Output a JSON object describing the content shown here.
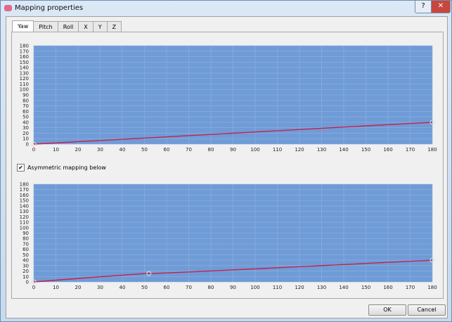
{
  "window": {
    "title": "Mapping properties",
    "help_label": "?",
    "close_label": "✕"
  },
  "tabs": [
    {
      "label": "Yaw",
      "active": true
    },
    {
      "label": "Pitch"
    },
    {
      "label": "Roll"
    },
    {
      "label": "X"
    },
    {
      "label": "Y"
    },
    {
      "label": "Z"
    }
  ],
  "asymmetric": {
    "label": "Asymmetric mapping below",
    "checked": true,
    "check_glyph": "✔"
  },
  "buttons": {
    "ok": "OK",
    "cancel": "Cancel"
  },
  "colors": {
    "plot_bg": "#6f9bd6",
    "grid": "#8fb3e3",
    "curve": "#c8204a"
  },
  "chart_data": [
    {
      "type": "line",
      "xlim": [
        0,
        180
      ],
      "ylim": [
        0,
        180
      ],
      "grid": true,
      "xticks": [
        0,
        10,
        20,
        30,
        40,
        50,
        60,
        70,
        80,
        90,
        100,
        110,
        120,
        130,
        140,
        150,
        160,
        170,
        180
      ],
      "yticks": [
        0,
        10,
        20,
        30,
        40,
        50,
        60,
        70,
        80,
        90,
        100,
        110,
        120,
        130,
        140,
        150,
        160,
        170,
        180
      ],
      "points": [
        [
          0,
          0
        ],
        [
          180,
          40
        ]
      ],
      "handles": [
        [
          0,
          0
        ],
        [
          180,
          40
        ]
      ]
    },
    {
      "type": "line",
      "xlim": [
        0,
        180
      ],
      "ylim": [
        0,
        180
      ],
      "grid": true,
      "xticks": [
        0,
        10,
        20,
        30,
        40,
        50,
        60,
        70,
        80,
        90,
        100,
        110,
        120,
        130,
        140,
        150,
        160,
        170,
        180
      ],
      "yticks": [
        0,
        10,
        20,
        30,
        40,
        50,
        60,
        70,
        80,
        90,
        100,
        110,
        120,
        130,
        140,
        150,
        160,
        170,
        180
      ],
      "points": [
        [
          0,
          0
        ],
        [
          52,
          15.5
        ],
        [
          180,
          40
        ]
      ],
      "handles": [
        [
          0,
          0
        ],
        [
          52,
          15.5
        ],
        [
          180,
          40
        ]
      ]
    }
  ]
}
